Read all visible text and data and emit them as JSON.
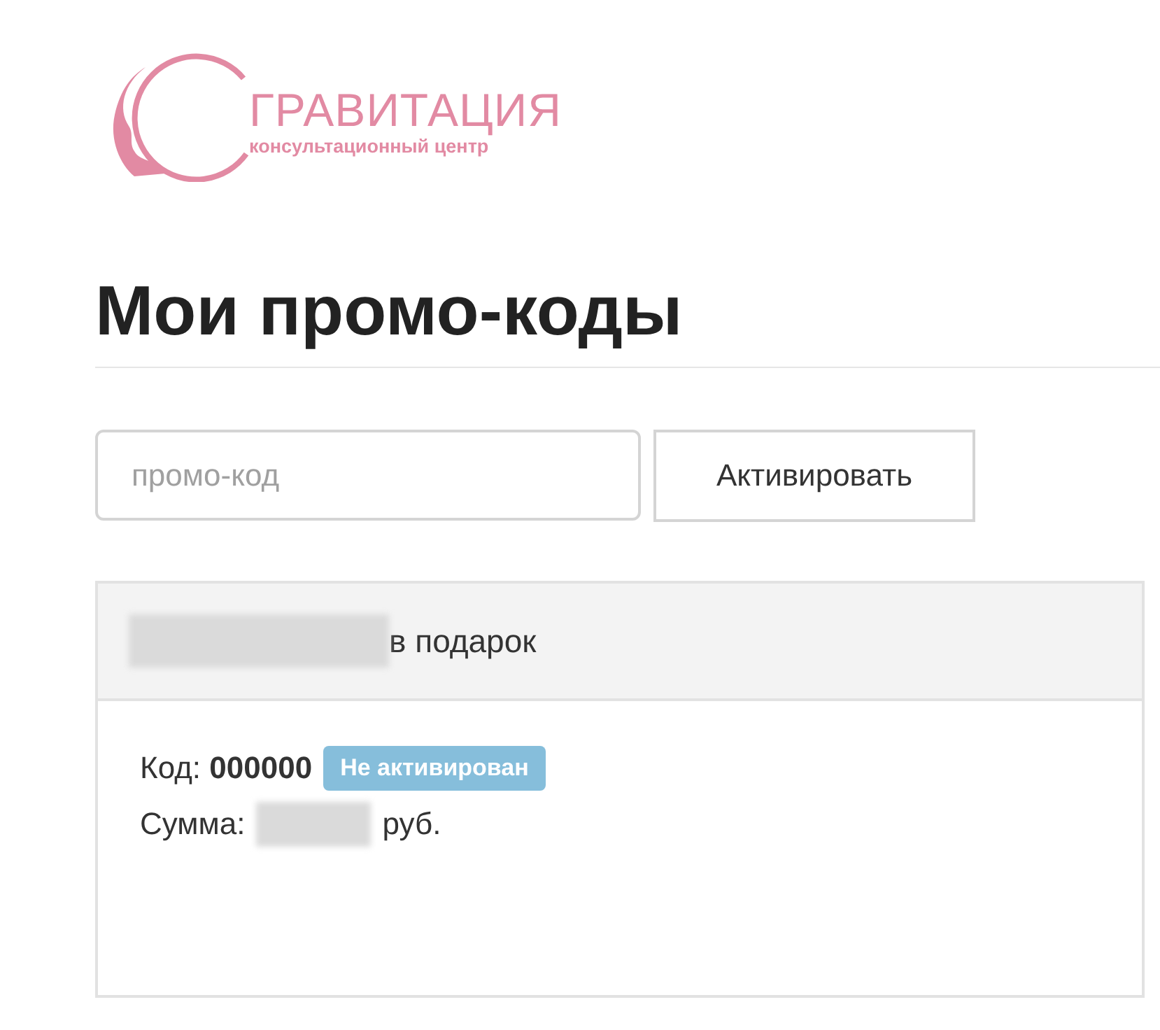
{
  "logo": {
    "name": "ГРАВИТАЦИЯ",
    "tagline": "консультационный центр"
  },
  "page_title": "Мои промо-коды",
  "promo_form": {
    "placeholder": "промо-код",
    "button": "Активировать"
  },
  "promo_cards": [
    {
      "title_suffix": "в подарок",
      "code": "Код: **000000**",
      "status": "Не активирован",
      "activated": false,
      "sum_label": "Сумма:",
      "sum_unit": "руб."
    }
  ]
}
